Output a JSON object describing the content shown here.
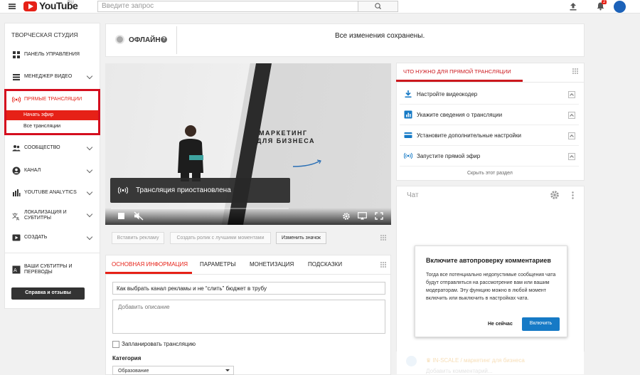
{
  "topbar": {
    "logo_text": "YouTube",
    "region": "RU",
    "search_placeholder": "Введите запрос",
    "notification_count": "2"
  },
  "sidebar": {
    "title": "ТВОРЧЕСКАЯ СТУДИЯ",
    "items": [
      {
        "label": "ПАНЕЛЬ УПРАВЛЕНИЯ"
      },
      {
        "label": "МЕНЕДЖЕР ВИДЕО"
      },
      {
        "label": "ПРЯМЫЕ ТРАНСЛЯЦИИ"
      },
      {
        "label": "СООБЩЕСТВО"
      },
      {
        "label": "КАНАЛ"
      },
      {
        "label": "YOUTUBE ANALYTICS"
      },
      {
        "label": "ЛОКАЛИЗАЦИЯ И СУБТИТРЫ"
      },
      {
        "label": "СОЗДАТЬ"
      },
      {
        "label": "ВАШИ СУБТИТРЫ И ПЕРЕВОДЫ"
      }
    ],
    "live_sub": [
      "Начать эфир",
      "Все трансляции"
    ],
    "feedback_button": "Справка и отзывы"
  },
  "status": {
    "state": "ОФЛАЙН",
    "help": "?",
    "saved_message": "Все изменения сохранены."
  },
  "video": {
    "headline_1": "МАРКЕТИНГ",
    "headline_2": "ДЛЯ БИЗНЕСА",
    "paused_text": "Трансляция приостановлена"
  },
  "video_tools": {
    "insert_ad": "Вставить рекламу",
    "highlights": "Создать ролик с лучшими моментами",
    "change_thumbnail": "Изменить значок"
  },
  "tabs": [
    "ОСНОВНАЯ ИНФОРМАЦИЯ",
    "ПАРАМЕТРЫ",
    "МОНЕТИЗАЦИЯ",
    "ПОДСКАЗКИ"
  ],
  "form": {
    "title_value": "Как выбрать канал рекламы и не “слить” бюджет в трубу",
    "description_placeholder": "Добавить описание",
    "schedule_label": "Запланировать трансляцию",
    "category_label": "Категория",
    "category_value": "Образование"
  },
  "checklist": {
    "title": "ЧТО НУЖНО ДЛЯ ПРЯМОЙ ТРАНСЛЯЦИИ",
    "items": [
      {
        "label": "Настройте видеокодер",
        "icon": "download-icon"
      },
      {
        "label": "Укажите сведения о трансляции",
        "icon": "chart-icon"
      },
      {
        "label": "Установите дополнительные настройки",
        "icon": "card-icon"
      },
      {
        "label": "Запустите прямой эфир",
        "icon": "broadcast-icon"
      }
    ],
    "hide_label": "Скрыть этот раздел"
  },
  "chat": {
    "title": "Чат",
    "popup_title": "Включите автопроверку комментариев",
    "popup_body": "Тогда все потенциально недопустимые сообщения чата будут отправляться на рассмотрение вам или вашим модераторам. Эту функцию можно в любой момент включить или выключить в настройках чата.",
    "later_button": "Не сейчас",
    "enable_button": "Включить",
    "user_name": "IN-SCALE / маркетинг для бизнеса",
    "comment_placeholder": "Добавить комментарий..."
  },
  "colors": {
    "accent_red": "#e62117",
    "blue_button": "#167ac6"
  }
}
